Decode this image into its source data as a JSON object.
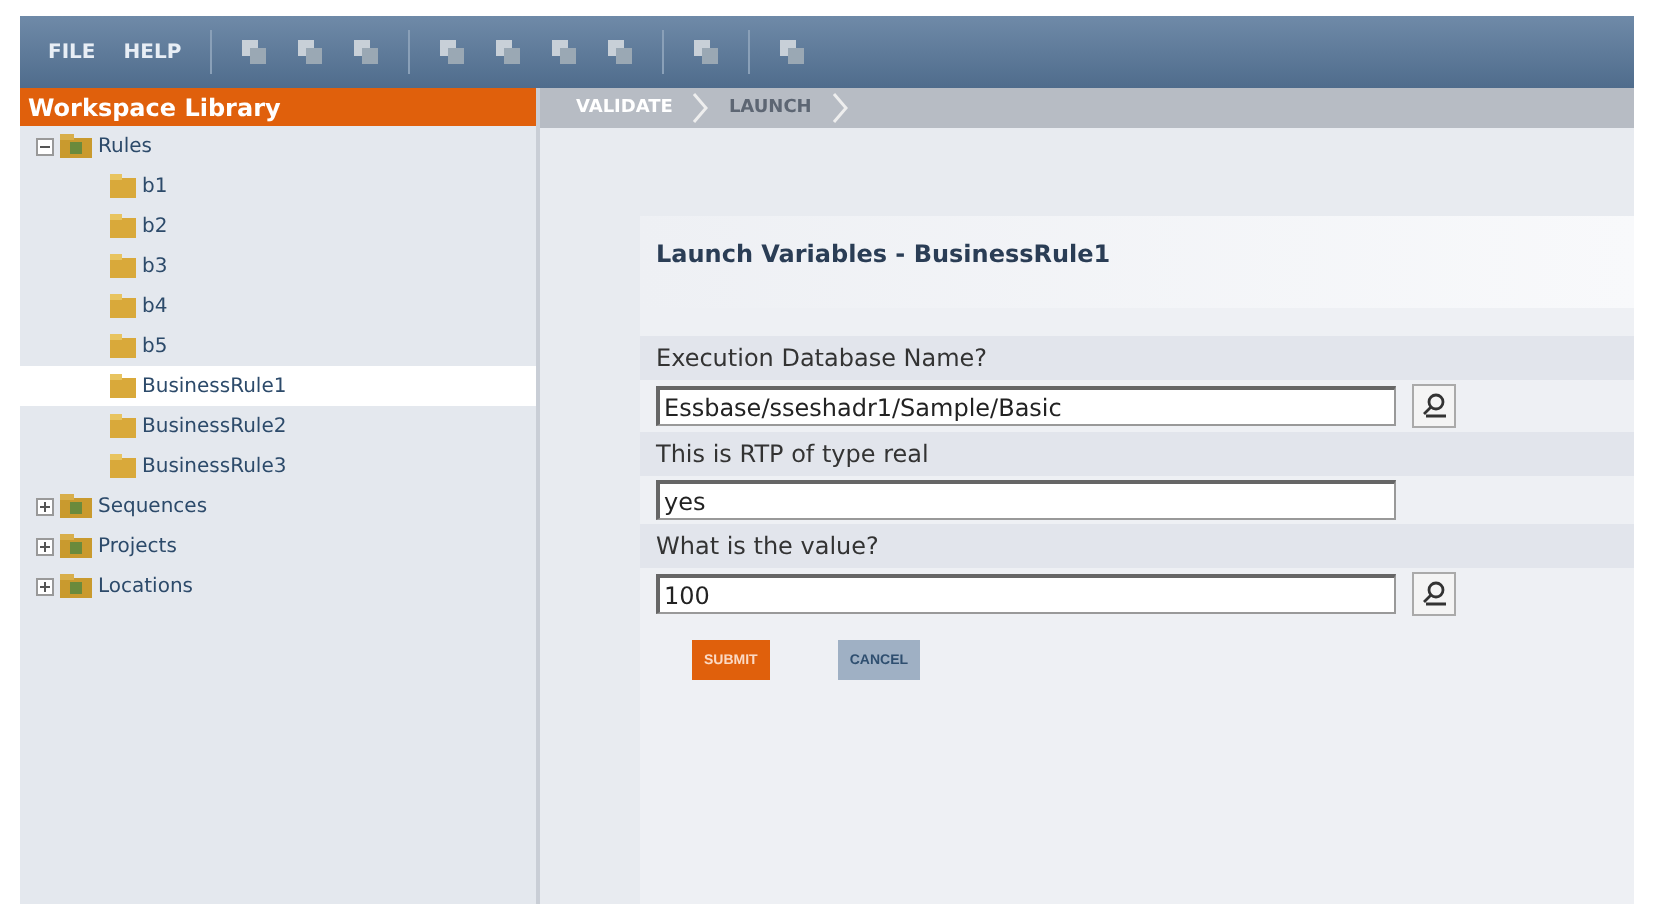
{
  "menu": [
    "FILE",
    "HELP"
  ],
  "sidebar": {
    "title": "Workspace Library",
    "tree": [
      {
        "label": "Rules",
        "expanded": true,
        "selected": false,
        "children": [
          {
            "label": "b1",
            "selected": false
          },
          {
            "label": "b2",
            "selected": false
          },
          {
            "label": "b3",
            "selected": false
          },
          {
            "label": "b4",
            "selected": false
          },
          {
            "label": "b5",
            "selected": false
          },
          {
            "label": "BusinessRule1",
            "selected": true
          },
          {
            "label": "BusinessRule2",
            "selected": false
          },
          {
            "label": "BusinessRule3",
            "selected": false
          }
        ]
      },
      {
        "label": "Sequences",
        "expanded": false,
        "selected": false
      },
      {
        "label": "Projects",
        "expanded": false,
        "selected": false
      },
      {
        "label": "Locations",
        "expanded": false,
        "selected": false
      }
    ]
  },
  "steps": [
    {
      "label": "VALIDATE",
      "selected": true
    },
    {
      "label": "LAUNCH",
      "selected": false
    }
  ],
  "form": {
    "title": "Launch Variables - BusinessRule1",
    "fields": [
      {
        "label": "Execution Database Name?",
        "value": "Essbase/sseshadr1/Sample/Basic",
        "kind": "lookup"
      },
      {
        "label": "This is RTP of type real",
        "value": "yes",
        "kind": "plain"
      },
      {
        "label": "What is the value?",
        "value": "100",
        "kind": "lookup"
      }
    ],
    "buttons": [
      {
        "label": "SUBMIT",
        "kind": "primary"
      },
      {
        "label": "CANCEL",
        "kind": "secondary"
      }
    ]
  }
}
